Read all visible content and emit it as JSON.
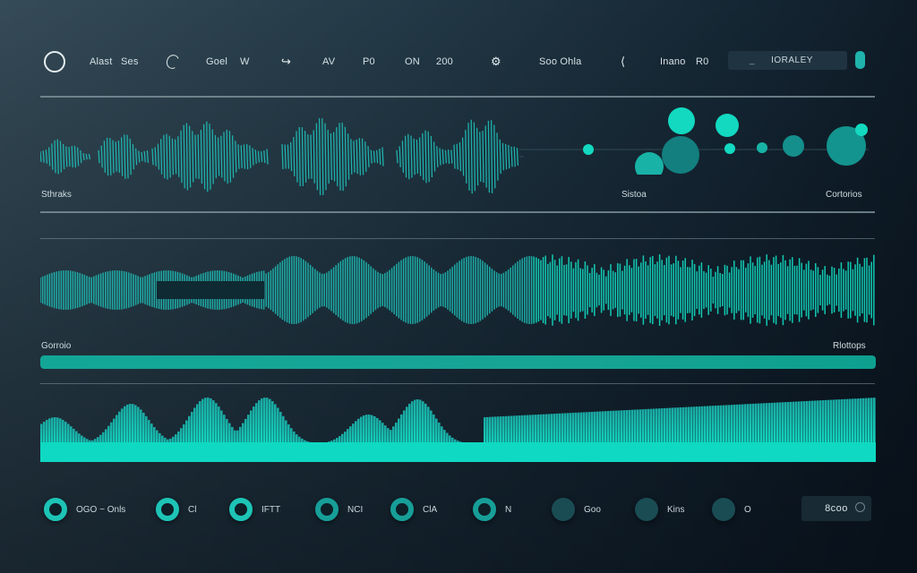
{
  "toolbar": {
    "items": [
      {
        "type": "icon",
        "icon": "circle-outline-icon"
      },
      {
        "type": "text",
        "label": "Alast"
      },
      {
        "type": "text",
        "label": "Ses"
      },
      {
        "type": "icon",
        "icon": "arc-icon"
      },
      {
        "type": "text",
        "label": "Goel"
      },
      {
        "type": "text",
        "label": "W"
      },
      {
        "type": "icon",
        "icon": "hook-icon"
      },
      {
        "type": "text",
        "label": "AV"
      },
      {
        "type": "text",
        "label": "P0"
      },
      {
        "type": "text",
        "label": "ON"
      },
      {
        "type": "text",
        "label": "200"
      },
      {
        "type": "icon",
        "icon": "swirl-icon"
      },
      {
        "type": "text",
        "label": "Soo Ohla"
      },
      {
        "type": "icon",
        "icon": "link-icon"
      },
      {
        "type": "text",
        "label": "Inano"
      },
      {
        "type": "text",
        "label": "R0"
      }
    ],
    "search": {
      "cursor": "_",
      "value": "IORALEY"
    },
    "toggle_state": "on"
  },
  "sections": {
    "top_left_label": "Sthraks",
    "top_mid_label": "Sistoa",
    "top_right_label": "Cortorios",
    "mid_left_label": "Gorroio",
    "mid_right_label": "Rlottops"
  },
  "progress": {
    "value_percent": 100
  },
  "colors": {
    "accent": "#1dc4b6",
    "accent_bright": "#12d9c0",
    "wave_teal": "#1fb7b0",
    "background_dark": "#0b1620",
    "background_light": "#354b57"
  },
  "controls": [
    {
      "kind": "ring",
      "label": "OGO ~ Onls",
      "active": true
    },
    {
      "kind": "ring",
      "label": "Cl",
      "active": true
    },
    {
      "kind": "ring",
      "label": "IFTT",
      "active": true
    },
    {
      "kind": "ring",
      "label": "NCI",
      "active": true
    },
    {
      "kind": "ring",
      "label": "ClA",
      "active": true
    },
    {
      "kind": "ring",
      "label": "N",
      "active": true
    },
    {
      "kind": "solid",
      "label": "Goo",
      "active": false
    },
    {
      "kind": "solid",
      "label": "Kins",
      "active": false
    },
    {
      "kind": "solid",
      "label": "O",
      "active": false
    }
  ],
  "value_display": {
    "value": "8coo",
    "icon": "reset-icon"
  }
}
